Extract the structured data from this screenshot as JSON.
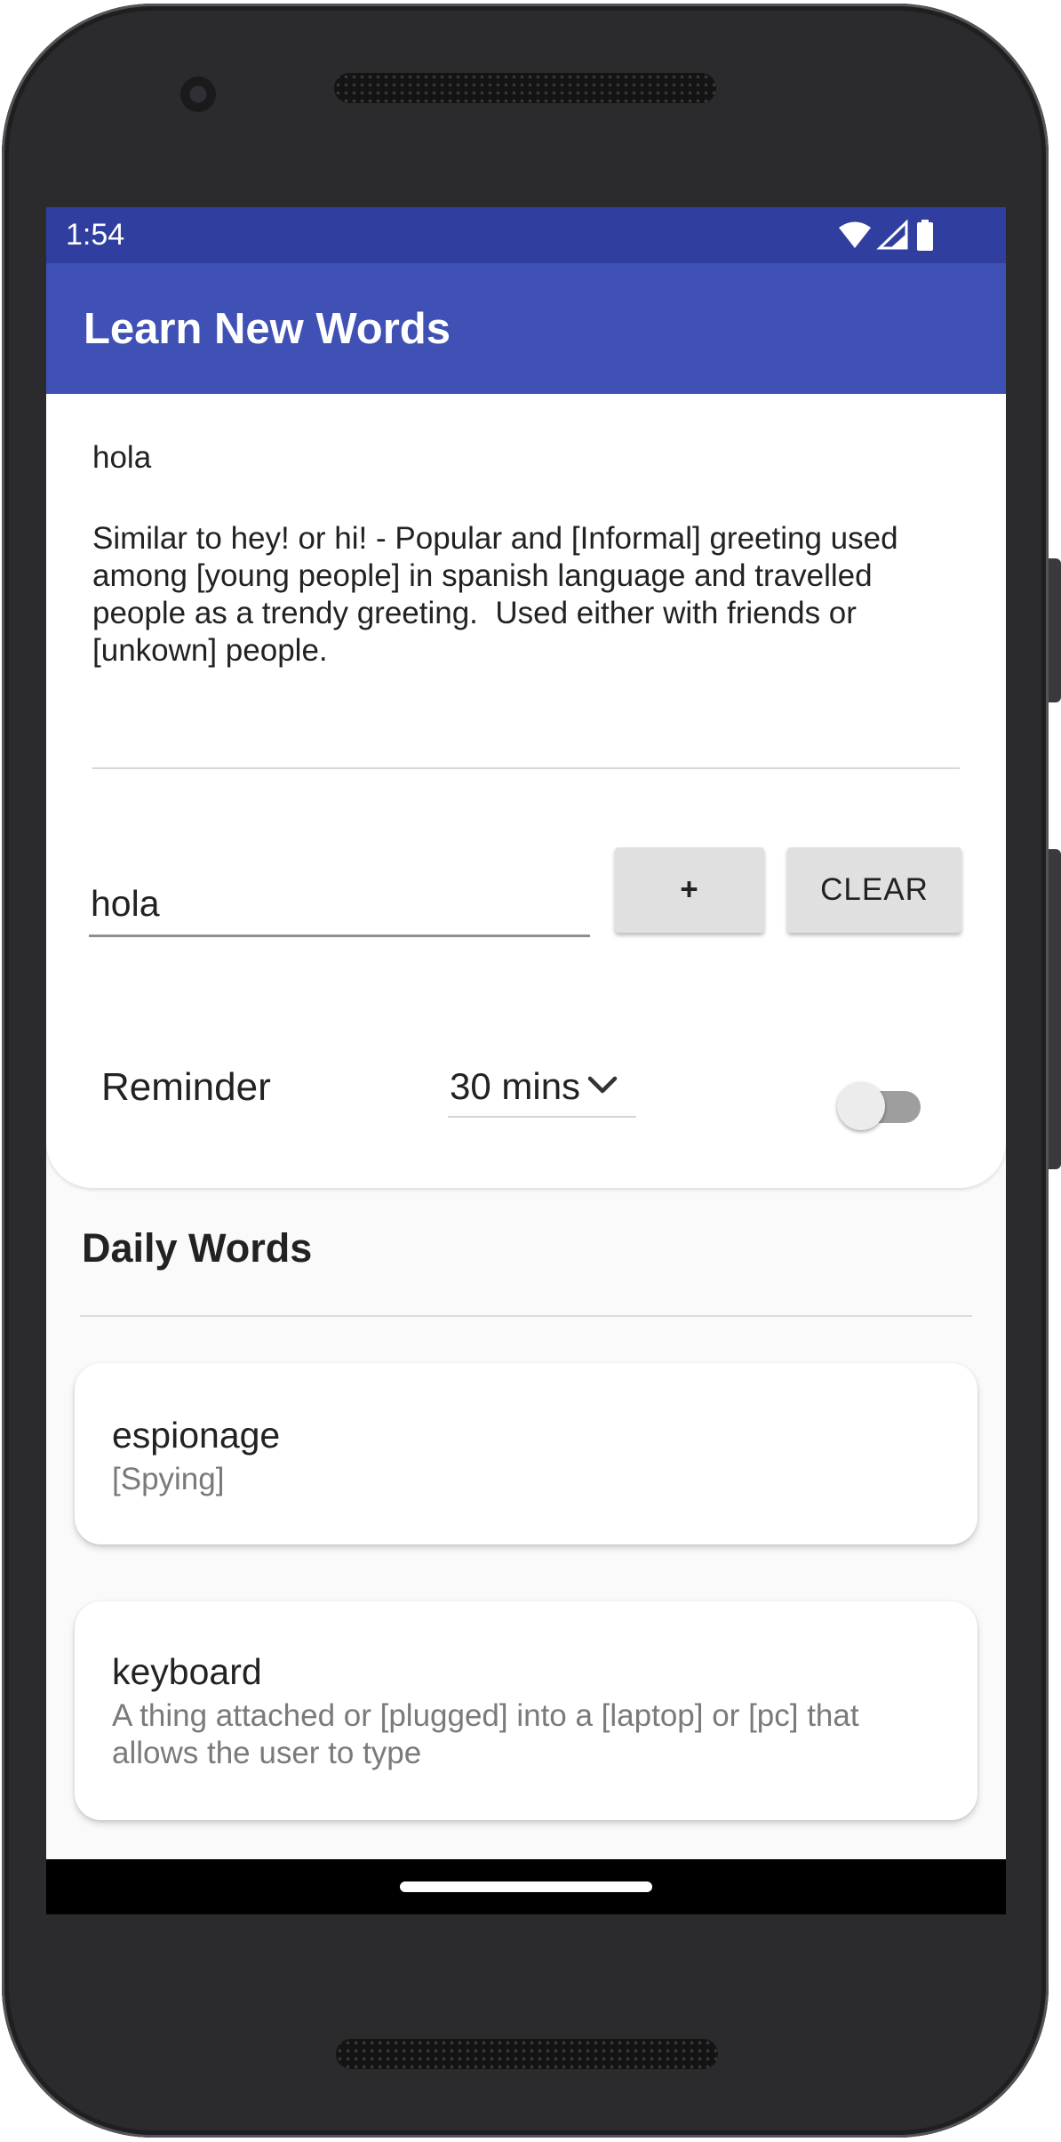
{
  "status_bar": {
    "time": "1:54",
    "icons": [
      "wifi-icon",
      "signal-icon",
      "battery-icon"
    ]
  },
  "app_bar": {
    "title": "Learn New Words"
  },
  "definition": {
    "word": "hola",
    "text": "Similar to hey! or hi! - Popular and [Informal] greeting used among [young people] in spanish language and travelled people as a trendy greeting.  Used either with friends or [unkown] people."
  },
  "word_input": {
    "value": "hola"
  },
  "buttons": {
    "add_label": "+",
    "clear_label": "CLEAR"
  },
  "reminder": {
    "label": "Reminder",
    "selected_interval": "30 mins",
    "enabled": false
  },
  "daily_words": {
    "title": "Daily Words",
    "items": [
      {
        "word": "espionage",
        "definition": "[Spying]"
      },
      {
        "word": "keyboard",
        "definition": "A thing attached or [plugged] into a [laptop] or [pc] that allows the user to type"
      }
    ]
  },
  "colors": {
    "status_bar": "#303f9f",
    "app_bar": "#3f51b5",
    "button": "#e0e0e0",
    "toggle_track_off": "#9e9e9e"
  }
}
